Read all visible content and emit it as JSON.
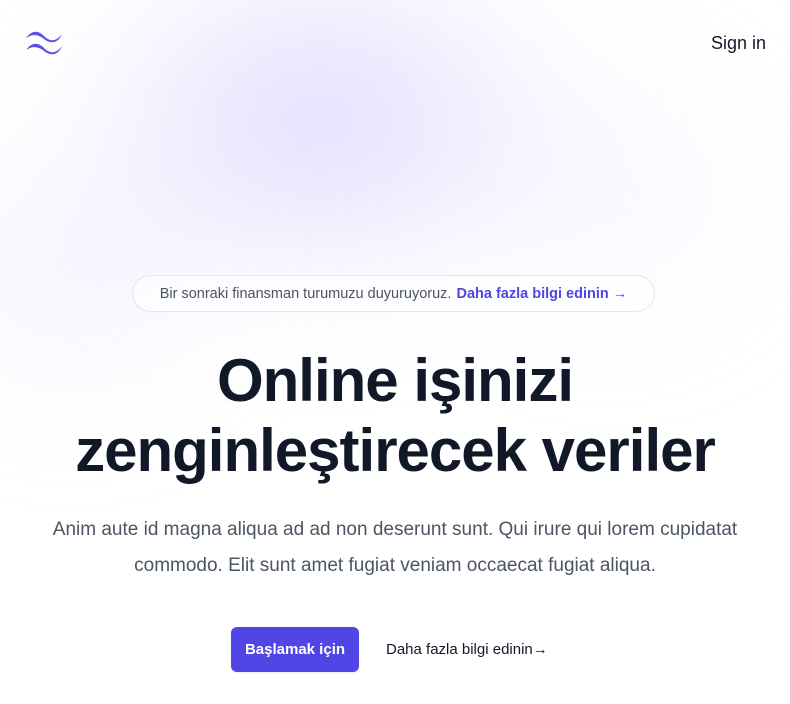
{
  "colors": {
    "accent": "#4f46e5",
    "heading": "#111827",
    "body_text": "#4b5563",
    "background_glow": "#ddd6fe"
  },
  "nav": {
    "logo_icon": "tailwind-wave-logo",
    "sign_in_label": "Sign in"
  },
  "announcement": {
    "text": "Bir sonraki finansman turumuzu duyuruyoruz.",
    "link_label": "Daha fazla bilgi edinin →"
  },
  "hero": {
    "headline_line1": "Online işinizi",
    "headline_line2": "zenginleştirecek veriler",
    "description_line1": "Anim aute id magna aliqua ad ad non deserunt sunt. Qui irure qui lorem cupidatat",
    "description_line2": "commodo. Elit sunt amet fugiat veniam occaecat fugiat aliqua.",
    "primary_button_label": "Başlamak için",
    "secondary_link_label": "Daha fazla bilgi edinin→"
  }
}
